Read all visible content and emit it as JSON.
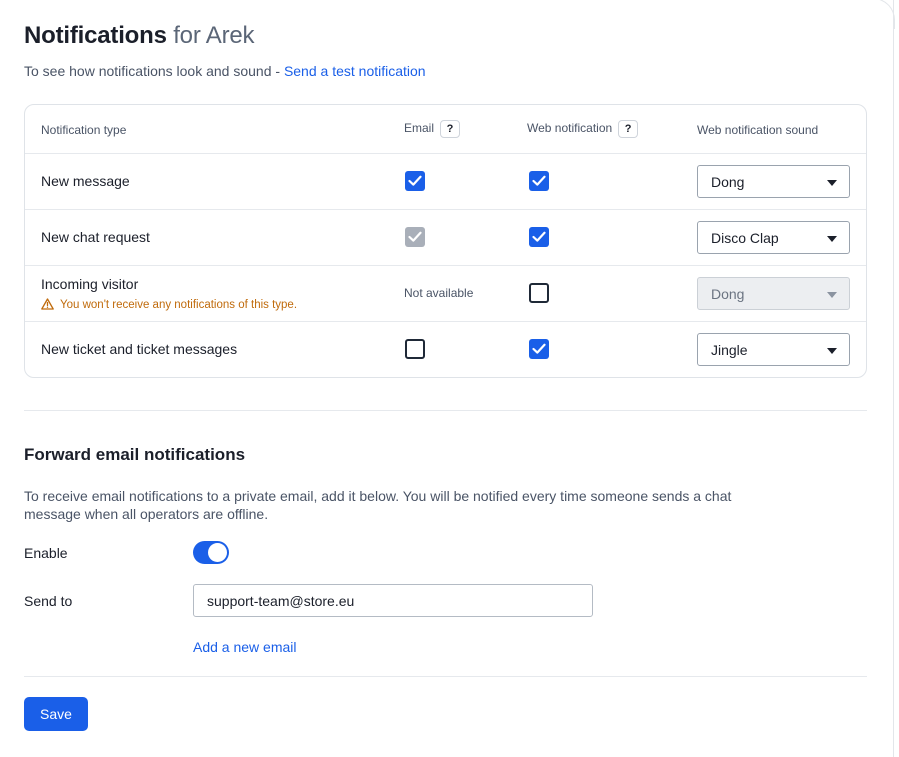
{
  "header": {
    "title": "Notifications",
    "title_suffix": "for Arek",
    "subtitle": "To see how notifications look and sound - ",
    "test_link": "Send a test notification"
  },
  "table": {
    "columns": {
      "type": "Notification type",
      "email": "Email",
      "web": "Web notification",
      "sound": "Web notification sound"
    },
    "help_label": "?",
    "rows": [
      {
        "label": "New message",
        "email": "checked",
        "web": "checked",
        "sound": "Dong",
        "sound_disabled": false
      },
      {
        "label": "New chat request",
        "email": "checked-disabled",
        "web": "checked",
        "sound": "Disco Clap",
        "sound_disabled": false
      },
      {
        "label": "Incoming visitor",
        "warning": "You won't receive any notifications of this type.",
        "email_text": "Not available",
        "web": "unchecked",
        "sound": "Dong",
        "sound_disabled": true
      },
      {
        "label": "New ticket and ticket messages",
        "email": "unchecked",
        "web": "checked",
        "sound": "Jingle",
        "sound_disabled": false
      }
    ]
  },
  "forward": {
    "title": "Forward email notifications",
    "description": "To receive email notifications to a private email, add it below. You will be notified every time someone sends a chat message when all operators are offline.",
    "enable_label": "Enable",
    "enabled": true,
    "send_to_label": "Send to",
    "send_to_value": "support-team@store.eu",
    "add_email": "Add a new email"
  },
  "save_label": "Save",
  "colors": {
    "accent": "#1a5fe8",
    "warning": "#c06b0c",
    "disabled": "#a9afb9"
  }
}
